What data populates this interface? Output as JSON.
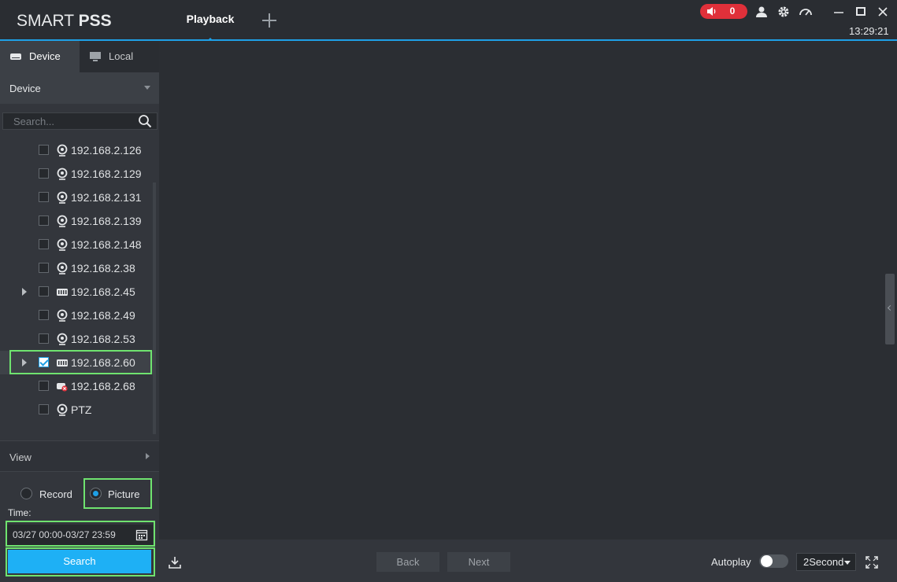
{
  "app": {
    "logo_light": "SMART ",
    "logo_bold": "PSS",
    "tab_active": "Playback",
    "alarm_count": "0",
    "clock": "13:29:21",
    "accent": "#1ea0e6",
    "alarm_color": "#e0303a"
  },
  "left_panel": {
    "tabs": [
      {
        "label": "Device",
        "icon": "device-icon",
        "active": true
      },
      {
        "label": "Local",
        "icon": "monitor-icon",
        "active": false
      }
    ],
    "device_dropdown": "Device",
    "search_placeholder": "Search...",
    "tree": [
      {
        "label": "192.168.2.126",
        "icon": "camera-icon",
        "expandable": false,
        "checked": false
      },
      {
        "label": "192.168.2.129",
        "icon": "camera-icon",
        "expandable": false,
        "checked": false
      },
      {
        "label": "192.168.2.131",
        "icon": "camera-icon",
        "expandable": false,
        "checked": false
      },
      {
        "label": "192.168.2.139",
        "icon": "camera-icon",
        "expandable": false,
        "checked": false
      },
      {
        "label": "192.168.2.148",
        "icon": "camera-icon",
        "expandable": false,
        "checked": false
      },
      {
        "label": "192.168.2.38",
        "icon": "camera-icon",
        "expandable": false,
        "checked": false
      },
      {
        "label": "192.168.2.45",
        "icon": "nvr-icon",
        "expandable": true,
        "checked": false
      },
      {
        "label": "192.168.2.49",
        "icon": "camera-icon",
        "expandable": false,
        "checked": false
      },
      {
        "label": "192.168.2.53",
        "icon": "camera-icon",
        "expandable": false,
        "checked": false
      },
      {
        "label": "192.168.2.60",
        "icon": "nvr-icon",
        "expandable": true,
        "checked": true
      },
      {
        "label": "192.168.2.68",
        "icon": "camera-offline-icon",
        "expandable": false,
        "checked": false
      },
      {
        "label": "PTZ",
        "icon": "camera-icon",
        "expandable": false,
        "checked": false
      }
    ],
    "view_dropdown": "View",
    "radio_record": "Record",
    "radio_picture": "Picture",
    "time_label": "Time:",
    "time_value": "03/27 00:00-03/27 23:59",
    "search_button": "Search"
  },
  "bottom_bar": {
    "back": "Back",
    "next": "Next",
    "autoplay": "Autoplay",
    "interval": "2Second"
  }
}
